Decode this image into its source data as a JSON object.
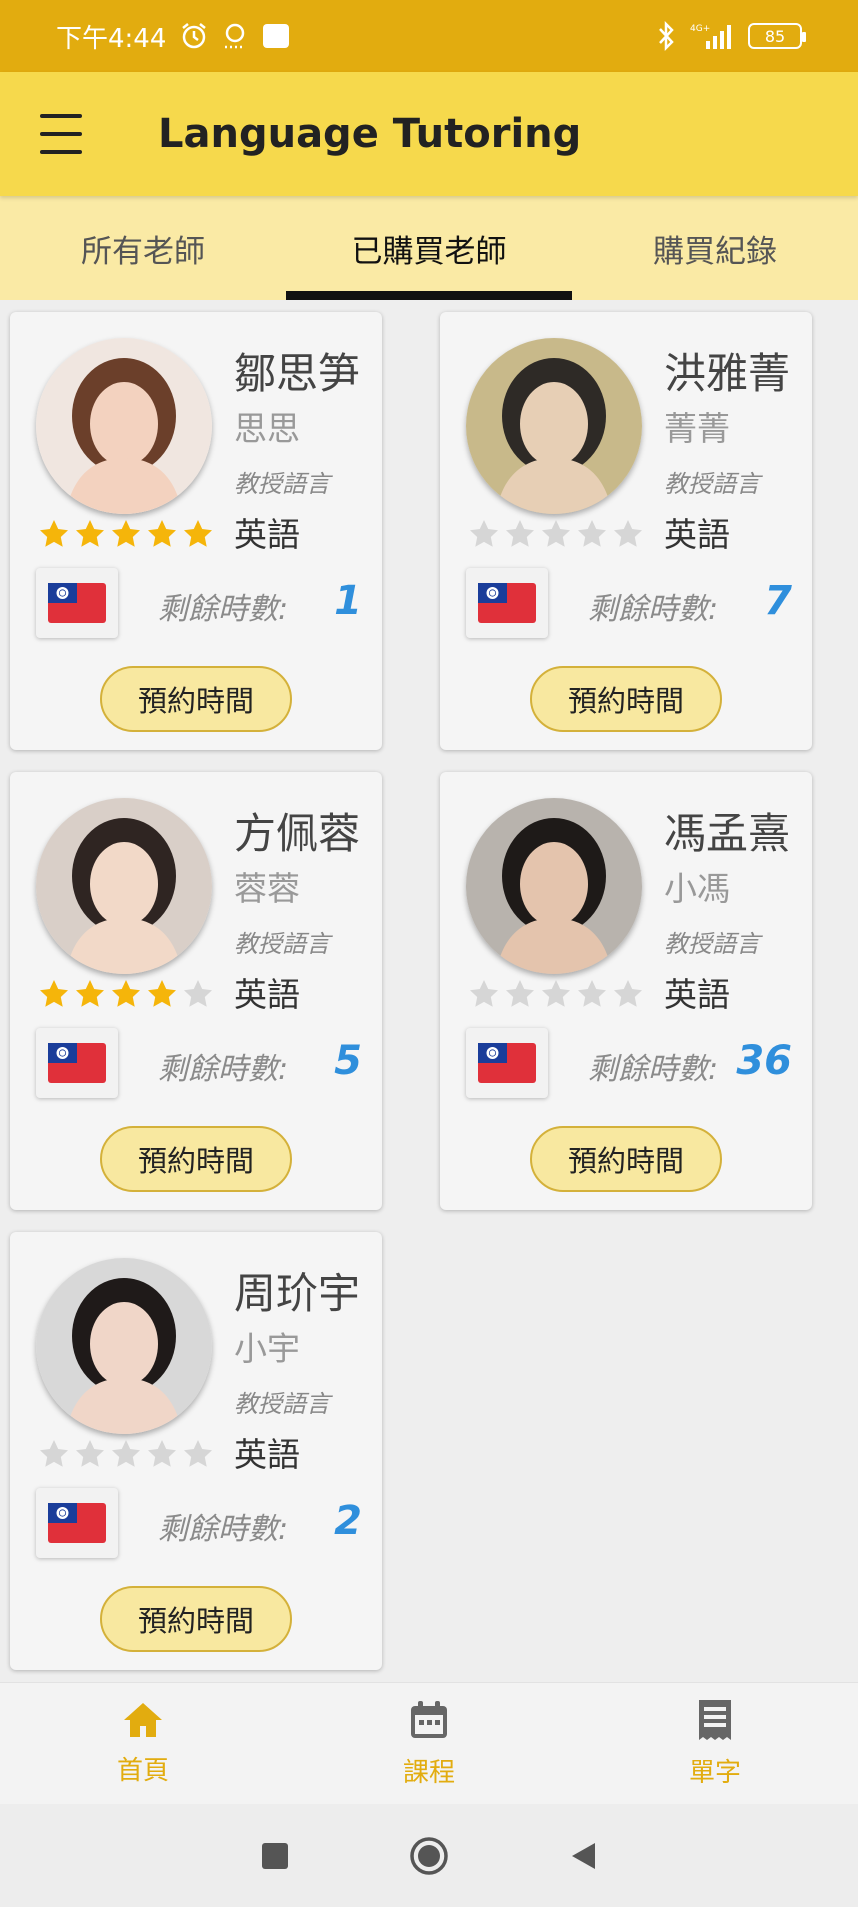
{
  "status_bar": {
    "time": "下午4:44",
    "network": "4G+",
    "battery": "85"
  },
  "app_bar": {
    "title": "Language Tutoring",
    "menu_icon": "hamburger-menu-icon"
  },
  "tabs": [
    {
      "label": "所有老師",
      "active": false
    },
    {
      "label": "已購買老師",
      "active": true
    },
    {
      "label": "購買紀錄",
      "active": false
    }
  ],
  "teachers": [
    {
      "name": "鄒思笋",
      "nickname": "思思",
      "language_label": "教授語言",
      "language": "英語",
      "rating": 5,
      "remaining_label": "剩餘時數:",
      "remaining_hours": "1",
      "flag": "taiwan-flag",
      "book_label": "預約時間"
    },
    {
      "name": "洪雅菁",
      "nickname": "菁菁",
      "language_label": "教授語言",
      "language": "英語",
      "rating": 0,
      "remaining_label": "剩餘時數:",
      "remaining_hours": "7",
      "flag": "taiwan-flag",
      "book_label": "預約時間"
    },
    {
      "name": "方佩蓉",
      "nickname": "蓉蓉",
      "language_label": "教授語言",
      "language": "英語",
      "rating": 4,
      "remaining_label": "剩餘時數:",
      "remaining_hours": "5",
      "flag": "taiwan-flag",
      "book_label": "預約時間"
    },
    {
      "name": "馮孟熹",
      "nickname": "小馮",
      "language_label": "教授語言",
      "language": "英語",
      "rating": 0,
      "remaining_label": "剩餘時數:",
      "remaining_hours": "36",
      "flag": "taiwan-flag",
      "book_label": "預約時間"
    },
    {
      "name": "周玠宇",
      "nickname": "小宇",
      "language_label": "教授語言",
      "language": "英語",
      "rating": 0,
      "remaining_label": "剩餘時數:",
      "remaining_hours": "2",
      "flag": "taiwan-flag",
      "book_label": "預約時間"
    }
  ],
  "bottom_nav": [
    {
      "label": "首頁",
      "icon": "home-icon"
    },
    {
      "label": "課程",
      "icon": "calendar-icon"
    },
    {
      "label": "單字",
      "icon": "receipt-icon"
    }
  ],
  "colors": {
    "status_bar": "#e2ac0f",
    "app_bar": "#f6d94c",
    "tab_bar": "#faeaa5",
    "star_filled": "#f5b50a",
    "star_empty": "#d6d6d6",
    "hours_value": "#2f8fdc",
    "nav_accent": "#e2ac0f"
  }
}
